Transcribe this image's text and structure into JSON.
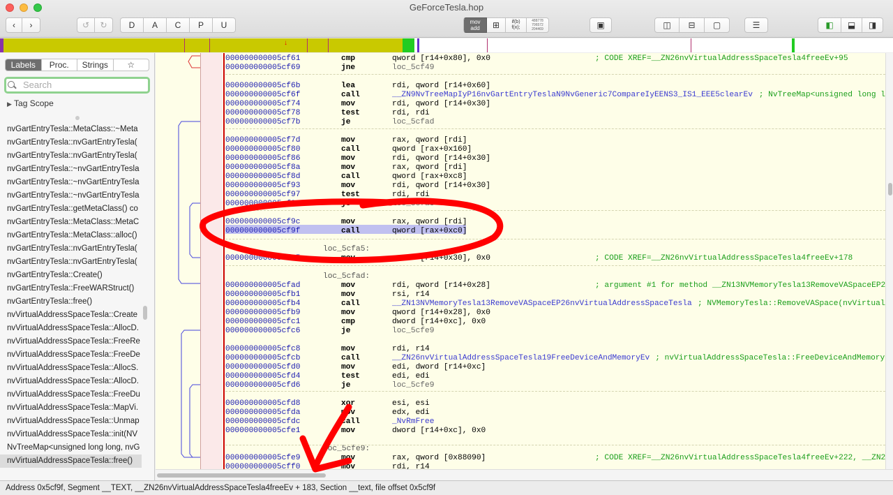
{
  "window": {
    "title": "GeForceTesla.hop"
  },
  "toolbar": {
    "mode_buttons": [
      "D",
      "A",
      "C",
      "P",
      "U"
    ],
    "mov_add": "mov\nadd",
    "if_label": "if(b)\nf(x);",
    "hex_label": "488778\n706572\n204469"
  },
  "sidebar": {
    "tabs": [
      "Labels",
      "Proc.",
      "Strings",
      "☆"
    ],
    "search_placeholder": "Search",
    "tag_scope": "Tag Scope",
    "labels": [
      "nvGartEntryTesla::MetaClass::~Meta",
      "nvGartEntryTesla::nvGartEntryTesla(",
      "nvGartEntryTesla::nvGartEntryTesla(",
      "nvGartEntryTesla::~nvGartEntryTesla",
      "nvGartEntryTesla::~nvGartEntryTesla",
      "nvGartEntryTesla::~nvGartEntryTesla",
      "nvGartEntryTesla::getMetaClass() co",
      "nvGartEntryTesla::MetaClass::MetaC",
      "nvGartEntryTesla::MetaClass::alloc()",
      "nvGartEntryTesla::nvGartEntryTesla(",
      "nvGartEntryTesla::nvGartEntryTesla(",
      "nvGartEntryTesla::Create()",
      "nvGartEntryTesla::FreeWARStruct()",
      "nvGartEntryTesla::free()",
      "nvVirtualAddressSpaceTesla::Create",
      "nvVirtualAddressSpaceTesla::AllocD.",
      "nvVirtualAddressSpaceTesla::FreeRe",
      "nvVirtualAddressSpaceTesla::FreeDe",
      "nvVirtualAddressSpaceTesla::AllocS.",
      "nvVirtualAddressSpaceTesla::AllocD.",
      "nvVirtualAddressSpaceTesla::FreeDu",
      "nvVirtualAddressSpaceTesla::MapVi.",
      "nvVirtualAddressSpaceTesla::Unmap",
      "nvVirtualAddressSpaceTesla::init(NV",
      "NvTreeMap<unsigned long long, nvG",
      "nvVirtualAddressSpaceTesla::free()"
    ]
  },
  "code": {
    "rows": [
      {
        "a": "000000000005cf61",
        "m": "cmp",
        "o": "qword [r14+0x80], 0x0",
        "c": "; CODE XREF=__ZN26nvVirtualAddressSpaceTesla4freeEv+95"
      },
      {
        "a": "000000000005cf69",
        "m": "jne",
        "o": "loc_5cf49"
      },
      {
        "a": "000000000005cf6b",
        "m": "lea",
        "o": "rdi, qword [r14+0x60]"
      },
      {
        "a": "000000000005cf6f",
        "m": "call",
        "o": "__ZN9NvTreeMapIyP16nvGartEntryTeslaN9NvGeneric7CompareIyEENS3_IS1_EEE5clearEv",
        "c": "; NvTreeMap<unsigned long lon"
      },
      {
        "a": "000000000005cf74",
        "m": "mov",
        "o": "rdi, qword [r14+0x30]"
      },
      {
        "a": "000000000005cf78",
        "m": "test",
        "o": "rdi, rdi"
      },
      {
        "a": "000000000005cf7b",
        "m": "je",
        "o": "loc_5cfad"
      },
      {
        "a": "000000000005cf7d",
        "m": "mov",
        "o": "rax, qword [rdi]"
      },
      {
        "a": "000000000005cf80",
        "m": "call",
        "o": "qword [rax+0x160]"
      },
      {
        "a": "000000000005cf86",
        "m": "mov",
        "o": "rdi, qword [r14+0x30]"
      },
      {
        "a": "000000000005cf8a",
        "m": "mov",
        "o": "rax, qword [rdi]"
      },
      {
        "a": "000000000005cf8d",
        "m": "call",
        "o": "qword [rax+0xc8]"
      },
      {
        "a": "000000000005cf93",
        "m": "mov",
        "o": "rdi, qword [r14+0x30]"
      },
      {
        "a": "000000000005cf97",
        "m": "test",
        "o": "rdi, rdi"
      },
      {
        "a": "000000000005cf9a",
        "m": "je",
        "o": "loc_5cfa5"
      },
      {
        "a": "000000000005cf9c",
        "m": "mov",
        "o": "rax, qword [rdi]"
      },
      {
        "a": "000000000005cf9f",
        "m": "call",
        "o": "qword [rax+0xc0]"
      },
      {
        "a": "000000000005cfa5",
        "m": "mov",
        "o": "qword [r14+0x30], 0x0",
        "c": "; CODE XREF=__ZN26nvVirtualAddressSpaceTesla4freeEv+178"
      },
      {
        "a": "000000000005cfad",
        "m": "mov",
        "o": "rdi, qword [r14+0x28]",
        "c": "; argument #1 for method __ZN13NVMemoryTesla13RemoveVASpaceEP26"
      },
      {
        "a": "000000000005cfb1",
        "m": "mov",
        "o": "rsi, r14"
      },
      {
        "a": "000000000005cfb4",
        "m": "call",
        "o": "__ZN13NVMemoryTesla13RemoveVASpaceEP26nvVirtualAddressSpaceTesla",
        "c": "; NVMemoryTesla::RemoveVASpace(nvVirtualA"
      },
      {
        "a": "000000000005cfb9",
        "m": "mov",
        "o": "qword [r14+0x28], 0x0"
      },
      {
        "a": "000000000005cfc1",
        "m": "cmp",
        "o": "dword [r14+0xc], 0x0"
      },
      {
        "a": "000000000005cfc6",
        "m": "je",
        "o": "loc_5cfe9"
      },
      {
        "a": "000000000005cfc8",
        "m": "mov",
        "o": "rdi, r14"
      },
      {
        "a": "000000000005cfcb",
        "m": "call",
        "o": "__ZN26nvVirtualAddressSpaceTesla19FreeDeviceAndMemoryEv",
        "c": "; nvVirtualAddressSpaceTesla::FreeDeviceAndMemory("
      },
      {
        "a": "000000000005cfd0",
        "m": "mov",
        "o": "edi, dword [r14+0xc]"
      },
      {
        "a": "000000000005cfd4",
        "m": "test",
        "o": "edi, edi"
      },
      {
        "a": "000000000005cfd6",
        "m": "je",
        "o": "loc_5cfe9"
      },
      {
        "a": "000000000005cfd8",
        "m": "xor",
        "o": "esi, esi"
      },
      {
        "a": "000000000005cfda",
        "m": "mov",
        "o": "edx, edi"
      },
      {
        "a": "000000000005cfdc",
        "m": "call",
        "o": "_NvRmFree"
      },
      {
        "a": "000000000005cfe1",
        "m": "mov",
        "o": "dword [r14+0xc], 0x0"
      },
      {
        "a": "000000000005cfe9",
        "m": "mov",
        "o": "rax, qword [0x88090]",
        "c": "; CODE XREF=__ZN26nvVirtualAddressSpaceTesla4freeEv+222, __ZN2"
      },
      {
        "a": "000000000005cff0",
        "m": "mov",
        "o": "rdi, r14"
      }
    ],
    "labels": [
      "loc_5cfa5:",
      "loc_5cfad:",
      "loc_5cfe9:"
    ]
  },
  "status": {
    "text": "Address 0x5cf9f, Segment __TEXT, __ZN26nvVirtualAddressSpaceTesla4freeEv + 183, Section __text, file offset 0x5cf9f"
  },
  "colors": {
    "nav_bar": "#c9c900",
    "annotation": "#ff0000",
    "address": "#1b1bb0",
    "comment": "#1a9e1a"
  }
}
